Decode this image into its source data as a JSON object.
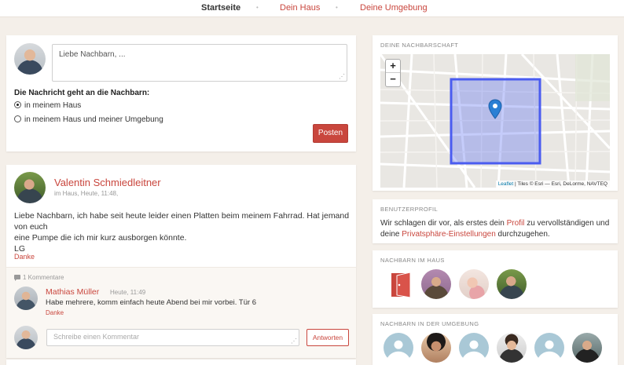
{
  "nav": {
    "tabs": [
      {
        "label": "Startseite"
      },
      {
        "label": "Dein Haus"
      },
      {
        "label": "Deine Umgebung"
      }
    ]
  },
  "composer": {
    "placeholder": "Liebe Nachbarn, ...",
    "recipients_label": "Die Nachricht geht an die Nachbarn:",
    "options": [
      {
        "label": "in meinem Haus",
        "selected": true
      },
      {
        "label": "in meinem Haus und meiner Umgebung",
        "selected": false
      }
    ],
    "submit_label": "Posten"
  },
  "post": {
    "author": "Valentin Schmiedleitner",
    "meta": "im Haus, Heute, 11:48,",
    "body_lines": [
      "Liebe Nachbarn, ich habe seit heute leider einen Platten beim meinem Fahrrad. Hat jemand von euch",
      "eine Pumpe die ich mir kurz ausborgen könnte.",
      "LG"
    ],
    "thanks_label": "Danke",
    "comment_count": "1 Kommentare",
    "comments": [
      {
        "author": "Mathias Müller",
        "time": "Heute, 11:49",
        "text": "Habe mehrere, komm einfach heute Abend bei mir vorbei. Tür 6",
        "thanks_label": "Danke"
      }
    ],
    "reply_placeholder": "Schreibe einen Kommentar",
    "reply_label": "Antworten"
  },
  "sidebar": {
    "map": {
      "title": "Deine Nachbarschaft",
      "zoom_in": "+",
      "zoom_out": "−",
      "attribution_link": "Leaflet",
      "attribution_rest": " | Tiles © Esri — Esri, DeLorme, NAVTEQ"
    },
    "profile": {
      "title": "Benutzerprofil",
      "text_1": "Wir schlagen dir vor, als erstes dein ",
      "link_profile": "Profil",
      "text_2": " zu vervollständigen und deine ",
      "link_privacy": "Privatsphäre-Einstellungen",
      "text_3": " durchzugehen."
    },
    "house": {
      "title": "Nachbarn im Haus"
    },
    "environment": {
      "title": "Nachbarn in der Umgebung"
    }
  },
  "colors": {
    "accent": "#c9463d",
    "background": "#f4efe9",
    "map_area": "#5a6cf0"
  }
}
